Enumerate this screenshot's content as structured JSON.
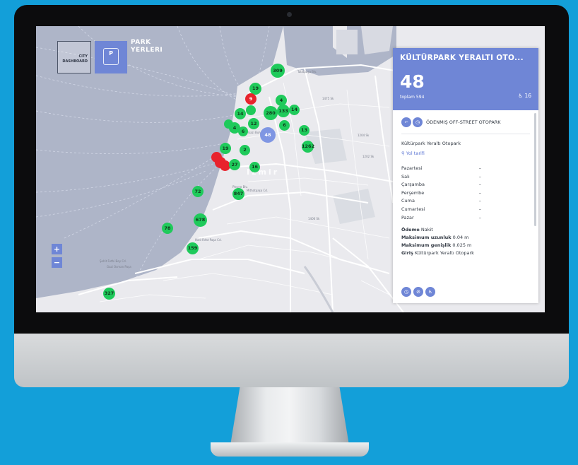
{
  "app": {
    "logo_text": "CITY DASHBOARD",
    "section_title_line1": "PARK",
    "section_title_line2": "YERLERI"
  },
  "map": {
    "city_label": "Izmir",
    "zoom_in": "+",
    "zoom_out": "−",
    "street_labels": [
      "Gazi Bulvarı",
      "Talatpaşa Blv.",
      "Mithatpaşa Cd.",
      "Plevne Blv.",
      "Halil Rıfat Paşa Cd.",
      "Şehit Fethi Bey Cd.",
      "Gazi Osman Paşa",
      "1204 Sk",
      "1202 Sk",
      "1406 Sk",
      "1475 Sk"
    ],
    "markers": [
      {
        "label": "309",
        "color": "green"
      },
      {
        "label": "19",
        "color": "green"
      },
      {
        "label": "9",
        "color": "red"
      },
      {
        "label": "4",
        "color": "green"
      },
      {
        "label": "14",
        "color": "green"
      },
      {
        "label": "",
        "color": "green"
      },
      {
        "label": "280",
        "color": "green"
      },
      {
        "label": "133",
        "color": "green"
      },
      {
        "label": "14",
        "color": "green"
      },
      {
        "label": "12",
        "color": "green"
      },
      {
        "label": "4",
        "color": "green"
      },
      {
        "label": "6",
        "color": "green"
      },
      {
        "label": "",
        "color": "green"
      },
      {
        "label": "48",
        "color": "blue"
      },
      {
        "label": "6",
        "color": "green"
      },
      {
        "label": "13",
        "color": "green"
      },
      {
        "label": "1262",
        "color": "green"
      },
      {
        "label": "19",
        "color": "green"
      },
      {
        "label": "2",
        "color": "green"
      },
      {
        "label": "",
        "color": "red"
      },
      {
        "label": "",
        "color": "red"
      },
      {
        "label": "",
        "color": "red"
      },
      {
        "label": "27",
        "color": "green"
      },
      {
        "label": "16",
        "color": "green"
      },
      {
        "label": "72",
        "color": "green"
      },
      {
        "label": "847",
        "color": "green"
      },
      {
        "label": "678",
        "color": "green"
      },
      {
        "label": "78",
        "color": "green"
      },
      {
        "label": "159",
        "color": "green"
      },
      {
        "label": "327",
        "color": "green"
      }
    ]
  },
  "panel": {
    "title": "KÜLTÜRPARK YERALTI OTO...",
    "available": "48",
    "total": "toplam 594",
    "accessible_icon": "wheelchair-icon",
    "accessible_count": "16",
    "type_icons": [
      "parking-sign-icon",
      "clock-icon"
    ],
    "type_label": "ÖDENMIŞ OFF-STREET OTOPARK",
    "name": "Kültürpark Yeraltı Otopark",
    "route_label": "Yol tarifi",
    "hours": [
      {
        "day": "Pazartesi",
        "value": "–"
      },
      {
        "day": "Salı",
        "value": "–"
      },
      {
        "day": "Çarşamba",
        "value": "–"
      },
      {
        "day": "Perşembe",
        "value": "–"
      },
      {
        "day": "Cuma",
        "value": "–"
      },
      {
        "day": "Cumartesi",
        "value": "–"
      },
      {
        "day": "Pazar",
        "value": "–"
      }
    ],
    "payment": {
      "label": "Ödeme",
      "value": "Nakit"
    },
    "max_length": {
      "label": "Maksimum uzunluk",
      "value": "0.04 m"
    },
    "max_width": {
      "label": "Maksimum genişlik",
      "value": "0.025 m"
    },
    "entrance": {
      "label": "Giriş",
      "value": "Kültürpark Yeraltı Otopark"
    },
    "bottom_icons": [
      "clock-icon",
      "no-parking-icon",
      "wheelchair-icon"
    ]
  },
  "colors": {
    "accent": "#6f86d6",
    "marker_green": "#1fca5b",
    "marker_red": "#e8232d",
    "background": "#139fd9"
  }
}
